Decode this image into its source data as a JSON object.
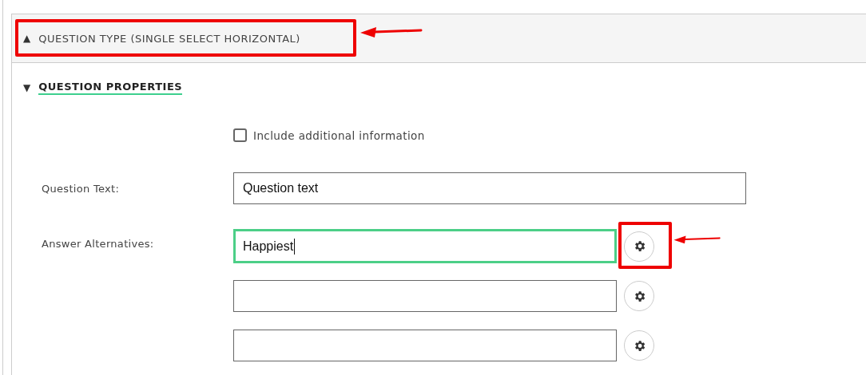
{
  "sections": [
    {
      "kind": "bar",
      "arrow": "▲",
      "title": "QUESTION TYPE (SINGLE SELECT HORIZONTAL)"
    },
    {
      "kind": "link",
      "arrow": "▼",
      "title": "QUESTION PROPERTIES"
    }
  ],
  "include_additional": {
    "label": "Include additional information",
    "checked": false
  },
  "question_text": {
    "label": "Question Text:",
    "value": "Question text"
  },
  "answer_alternatives": {
    "label": "Answer Alternatives:",
    "items": [
      {
        "value": "Happiest",
        "focused": true
      },
      {
        "value": "",
        "focused": false
      },
      {
        "value": "",
        "focused": false
      }
    ]
  },
  "annotations": [
    {
      "kind": "box-arrow"
    },
    {
      "kind": "box-arrow"
    }
  ]
}
